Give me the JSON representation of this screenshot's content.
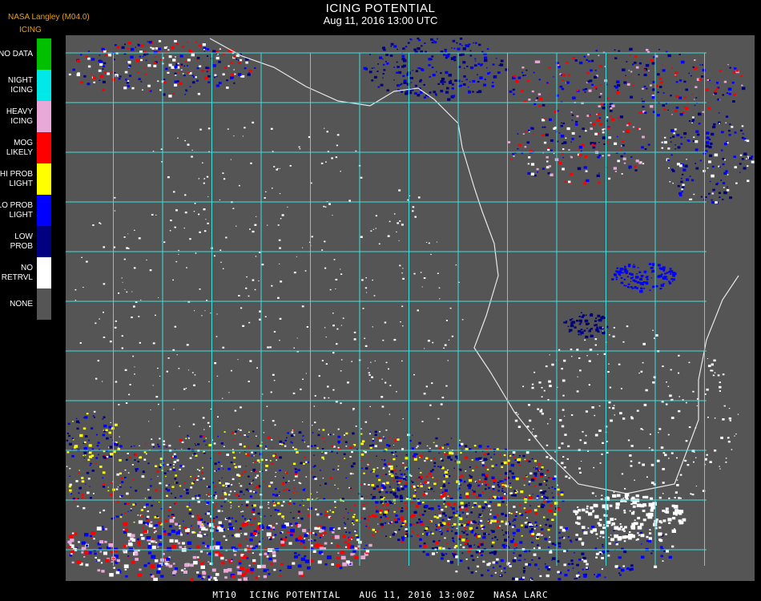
{
  "header": {
    "title": "ICING POTENTIAL",
    "subtitle": "Aug 11, 2016 13:00 UTC",
    "producer": "NASA Langley (M04.0)",
    "product": "ICING"
  },
  "legend": [
    {
      "label": "NO DATA",
      "color": "#00c000"
    },
    {
      "label": "NIGHT\nICING",
      "color": "#00e8e8"
    },
    {
      "label": "HEAVY\nICING",
      "color": "#e8a8d8"
    },
    {
      "label": "MOG\nLIKELY",
      "color": "#ff0000"
    },
    {
      "label": "HI PROB\nLIGHT",
      "color": "#ffff00"
    },
    {
      "label": "LO PROB\nLIGHT",
      "color": "#0000ff"
    },
    {
      "label": "LOW\nPROB",
      "color": "#000080"
    },
    {
      "label": "NO\nRETRVL",
      "color": "#ffffff"
    },
    {
      "label": "NONE",
      "color": "#555555"
    }
  ],
  "map": {
    "background_color": "#555555",
    "grid_color": "#40e0e0",
    "coast_color": "#e8e8e8"
  },
  "footer": "MT10  ICING POTENTIAL   AUG 11, 2016 13:00Z   NASA LARC"
}
